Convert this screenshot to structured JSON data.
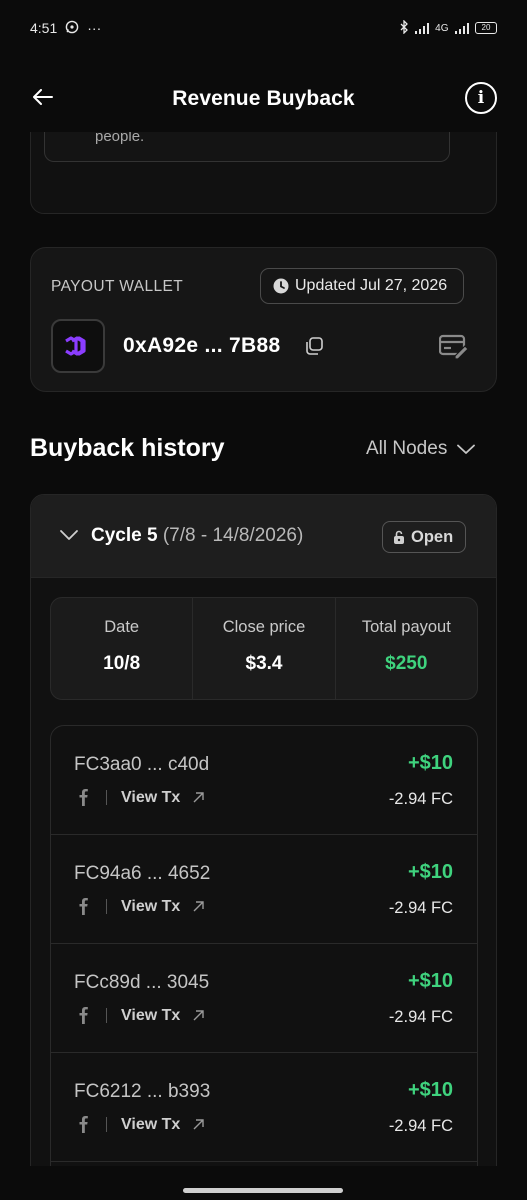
{
  "status_bar": {
    "time": "4:51",
    "dots": "···",
    "network": "4G",
    "battery": "20"
  },
  "header": {
    "title": "Revenue Buyback"
  },
  "previous_card": {
    "text": "people."
  },
  "wallet": {
    "label": "PAYOUT WALLET",
    "updated": "Updated Jul 27, 2026",
    "address": "0xA92e ... 7B88"
  },
  "history": {
    "title": "Buyback history",
    "filter": "All Nodes"
  },
  "cycle": {
    "name": "Cycle 5",
    "range": "(7/8 - 14/8/2026)",
    "status": "Open",
    "summary": {
      "date_label": "Date",
      "date_value": "10/8",
      "price_label": "Close price",
      "price_value": "$3.4",
      "payout_label": "Total payout",
      "payout_value": "$250"
    },
    "transactions": [
      {
        "id": "FC3aa0 ... c40d",
        "link": "View Tx",
        "amount": "+$10",
        "fc": "-2.94 FC"
      },
      {
        "id": "FC94a6 ... 4652",
        "link": "View Tx",
        "amount": "+$10",
        "fc": "-2.94 FC"
      },
      {
        "id": "FCc89d ... 3045",
        "link": "View Tx",
        "amount": "+$10",
        "fc": "-2.94 FC"
      },
      {
        "id": "FC6212 ... b393",
        "link": "View Tx",
        "amount": "+$10",
        "fc": "-2.94 FC"
      }
    ]
  }
}
